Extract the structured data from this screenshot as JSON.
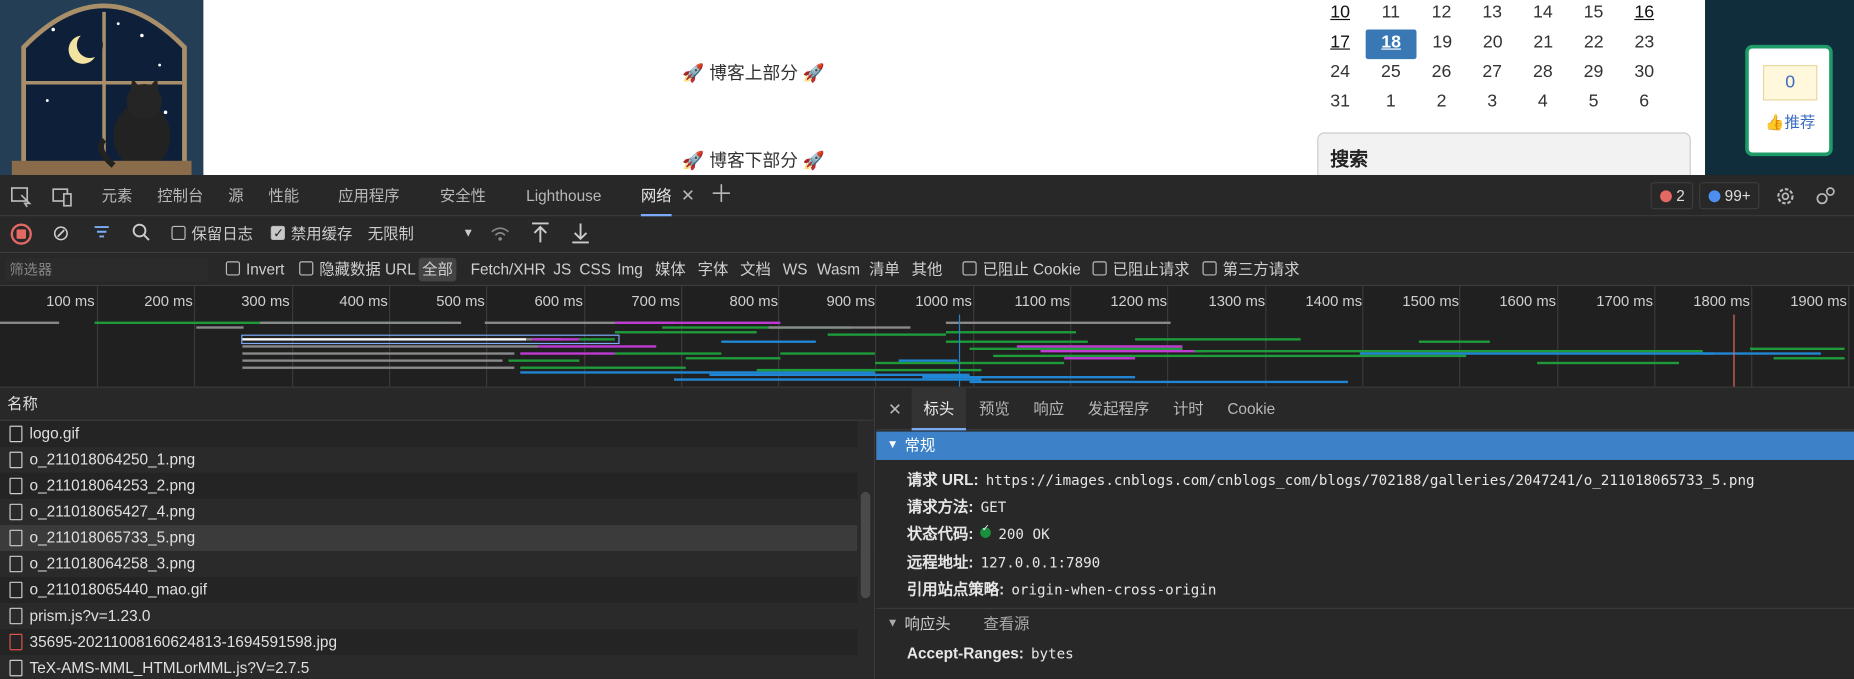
{
  "page": {
    "blog_top": "博客上部分",
    "blog_bottom": "博客下部分",
    "calendar": [
      [
        "10",
        "11",
        "12",
        "13",
        "14",
        "15",
        "16"
      ],
      [
        "17",
        "18",
        "19",
        "20",
        "21",
        "22",
        "23"
      ],
      [
        "24",
        "25",
        "26",
        "27",
        "28",
        "29",
        "30"
      ],
      [
        "31",
        "1",
        "2",
        "3",
        "4",
        "5",
        "6"
      ]
    ],
    "search_title": "搜索",
    "recommend_count": "0",
    "recommend_label": "推荐"
  },
  "devtools": {
    "tabs": [
      "元素",
      "控制台",
      "源",
      "性能",
      "应用程序",
      "安全性",
      "Lighthouse",
      "网络"
    ],
    "active_tab": "网络",
    "error_count": "2",
    "issue_count": "99+",
    "toolbar": {
      "preserve_log": "保留日志",
      "disable_cache": "禁用缓存",
      "throttle": "无限制"
    },
    "filter": {
      "placeholder": "筛选器",
      "invert": "Invert",
      "hide_data_url": "隐藏数据 URL",
      "types": [
        "全部",
        "Fetch/XHR",
        "JS",
        "CSS",
        "Img",
        "媒体",
        "字体",
        "文档",
        "WS",
        "Wasm",
        "清单",
        "其他"
      ],
      "blocked_cookies": "已阻止 Cookie",
      "blocked_requests": "已阻止请求",
      "third_party": "第三方请求"
    },
    "timeline_labels": [
      "100 ms",
      "200 ms",
      "300 ms",
      "400 ms",
      "500 ms",
      "600 ms",
      "700 ms",
      "800 ms",
      "900 ms",
      "1000 ms",
      "1100 ms",
      "1200 ms",
      "1300 ms",
      "1400 ms",
      "1500 ms",
      "1600 ms",
      "1700 ms",
      "1800 ms",
      "1900 ms"
    ],
    "list_header": "名称",
    "requests": [
      {
        "name": "logo.gif",
        "selected": false
      },
      {
        "name": "o_211018064250_1.png",
        "selected": false
      },
      {
        "name": "o_211018064253_2.png",
        "selected": false
      },
      {
        "name": "o_211018065427_4.png",
        "selected": false
      },
      {
        "name": "o_211018065733_5.png",
        "selected": true
      },
      {
        "name": "o_211018064258_3.png",
        "selected": false
      },
      {
        "name": "o_211018065440_mao.gif",
        "selected": false
      },
      {
        "name": "prism.js?v=1.23.0",
        "selected": false
      },
      {
        "name": "35695-20211008160624813-1694591598.jpg",
        "selected": false
      },
      {
        "name": "TeX-AMS-MML_HTMLorMML.js?V=2.7.5",
        "selected": false
      }
    ],
    "detail_tabs": [
      "标头",
      "预览",
      "响应",
      "发起程序",
      "计时",
      "Cookie"
    ],
    "general_title": "常规",
    "general": {
      "url_key": "请求 URL:",
      "url": "https://images.cnblogs.com/cnblogs_com/blogs/702188/galleries/2047241/o_211018065733_5.png",
      "method_key": "请求方法:",
      "method": "GET",
      "status_key": "状态代码:",
      "status": "200 OK",
      "remote_key": "远程地址:",
      "remote": "127.0.0.1:7890",
      "referrer_key": "引用站点策略:",
      "referrer": "origin-when-cross-origin"
    },
    "response_headers_title": "响应头",
    "view_source": "查看源",
    "accept_ranges_key": "Accept-Ranges:",
    "accept_ranges": "bytes"
  }
}
